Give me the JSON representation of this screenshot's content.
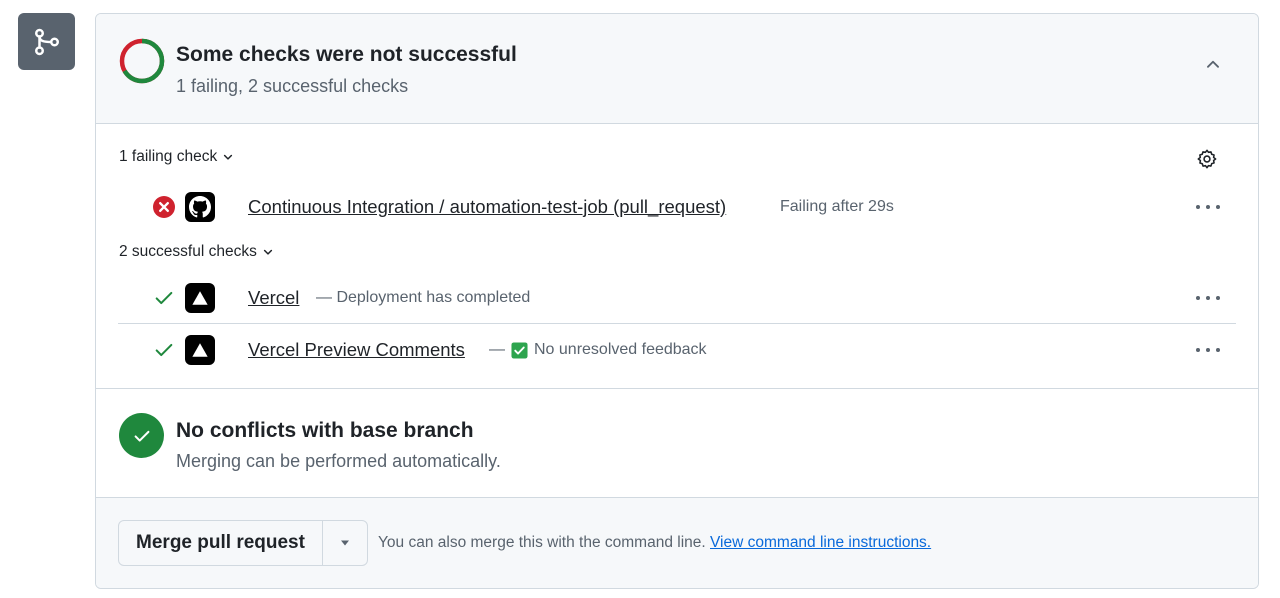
{
  "header": {
    "title": "Some checks were not successful",
    "subtitle": "1 failing, 2 successful checks",
    "status_ring": {
      "failing": 1,
      "successful": 2
    }
  },
  "failing_group": {
    "label": "1 failing check",
    "checks": [
      {
        "name": "Continuous Integration / automation-test-job (pull_request)",
        "description": "Failing after 29s",
        "status": "failure",
        "app_icon": "github-icon"
      }
    ]
  },
  "successful_group": {
    "label": "2 successful checks",
    "checks": [
      {
        "name": "Vercel",
        "description": "— Deployment has completed",
        "status": "success",
        "app_icon": "vercel-icon"
      },
      {
        "name": "Vercel Preview Comments",
        "description_prefix": "—",
        "description": "No unresolved feedback",
        "status": "success",
        "app_icon": "vercel-icon",
        "badge_icon": "check-box-icon"
      }
    ]
  },
  "conflicts": {
    "title": "No conflicts with base branch",
    "subtitle": "Merging can be performed automatically."
  },
  "merge": {
    "button_label": "Merge pull request",
    "note_prefix": "You can also merge this with the command line.",
    "link_label": "View command line instructions."
  },
  "colors": {
    "failure": "#cf222e",
    "success": "#1f883d",
    "muted": "#59636e",
    "link": "#0969da"
  }
}
